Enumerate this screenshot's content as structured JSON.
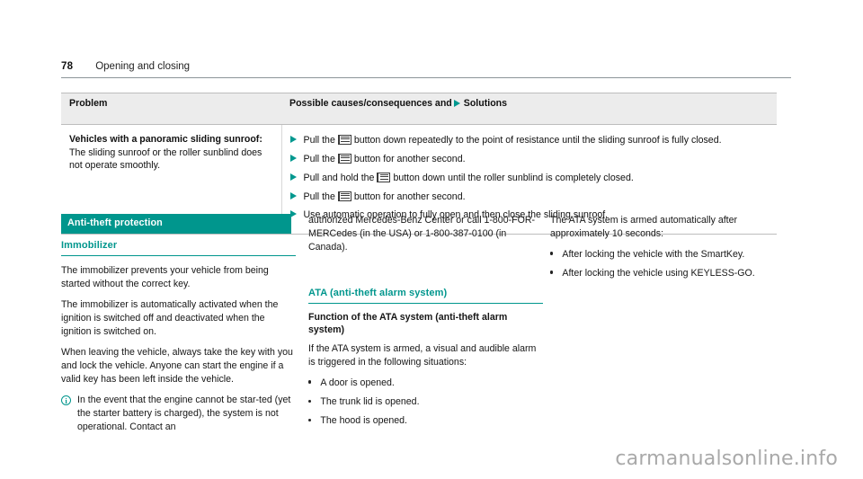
{
  "header": {
    "page_number": "78",
    "title": "Opening and closing"
  },
  "table": {
    "columns": {
      "problem": "Problem",
      "solutions_prefix": "Possible causes/consequences and",
      "solutions_suffix": "Solutions"
    },
    "row": {
      "problem_bold": "Vehicles with a panoramic sliding sunroof:",
      "problem_rest": " The sliding sunroof or the roller sunblind does not operate smoothly.",
      "solutions": [
        {
          "before": "Pull the",
          "icon": "sunroof-switch-icon",
          "after": "button down repeatedly to the point of resistance until the sliding sunroof is fully closed."
        },
        {
          "before": "Pull the",
          "icon": "sunroof-switch-icon",
          "after": "button for another second."
        },
        {
          "before": "Pull and hold the",
          "icon": "sunroof-switch-icon",
          "after": "button down until the roller sunblind is completely closed."
        },
        {
          "before": "Pull the",
          "icon": "sunroof-switch-icon",
          "after": "button for another second."
        },
        {
          "before": "Use automatic operation to fully open and then close the sliding sunroof.",
          "icon": null,
          "after": ""
        }
      ]
    }
  },
  "columns": {
    "left": {
      "section_bar": "Anti-theft protection",
      "sub_head": "Immobilizer",
      "paragraphs": [
        "The immobilizer prevents your vehicle from being started without the correct key.",
        "The immobilizer is automatically activated when the ignition is switched off and deactivated when the ignition is switched on.",
        "When leaving the vehicle, always take the key with you and lock the vehicle. Anyone can start the engine if a valid key has been left inside the vehicle."
      ],
      "note_icon": "info-icon",
      "note_glyph": "i",
      "note_text": "In the event that the engine cannot be star-ted (yet the starter battery is charged), the system is not operational. Contact an"
    },
    "middle": {
      "continuation": "authorized Mercedes-Benz Center or call 1-800-FOR-MERCedes (in the USA) or 1-800-387-0100 (in Canada).",
      "sub_head": "ATA (anti-theft alarm system)",
      "bold_head": "Function of the ATA system (anti-theft alarm system)",
      "intro": "If the ATA system is armed, a visual and audible alarm is triggered in the following situations:",
      "bullets": [
        "A door is opened.",
        "The trunk lid is opened.",
        "The hood is opened."
      ]
    },
    "right": {
      "intro": "The ATA system is armed automatically after approximately 10 seconds:",
      "bullets": [
        "After locking the vehicle with the SmartKey.",
        "After locking the vehicle using KEYLESS-GO."
      ]
    }
  },
  "watermark": "carmanualsonline.info",
  "colors": {
    "teal": "#00968d",
    "header_bg": "#ececec",
    "rule": "#bdbdbd"
  }
}
